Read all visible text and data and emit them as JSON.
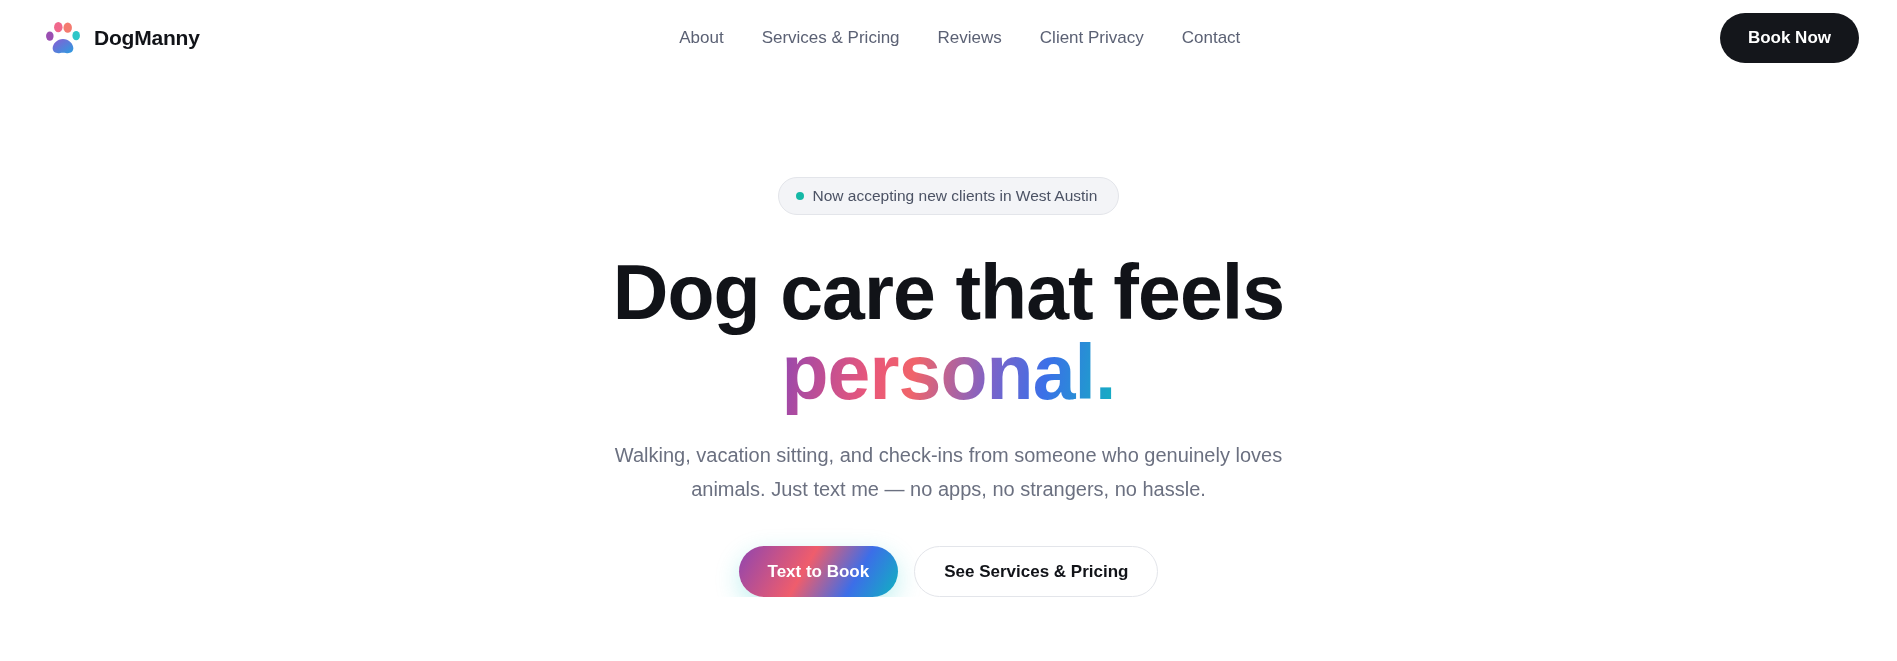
{
  "header": {
    "logo": "DogManny",
    "nav": [
      {
        "label": "About"
      },
      {
        "label": "Services & Pricing"
      },
      {
        "label": "Reviews"
      },
      {
        "label": "Client Privacy"
      },
      {
        "label": "Contact"
      }
    ],
    "cta": "Book Now"
  },
  "hero": {
    "badge": "Now accepting new clients in West Austin",
    "headline": "Dog care that feels",
    "headline_highlight": "personal.",
    "subtitle": "Walking, vacation sitting, and check-ins from someone who genuinely loves animals. Just text me — no apps, no strangers, no hassle.",
    "actions": [
      {
        "label": "Text to Book",
        "kind": "primary"
      },
      {
        "label": "See Services & Pricing",
        "kind": "secondary"
      }
    ]
  }
}
